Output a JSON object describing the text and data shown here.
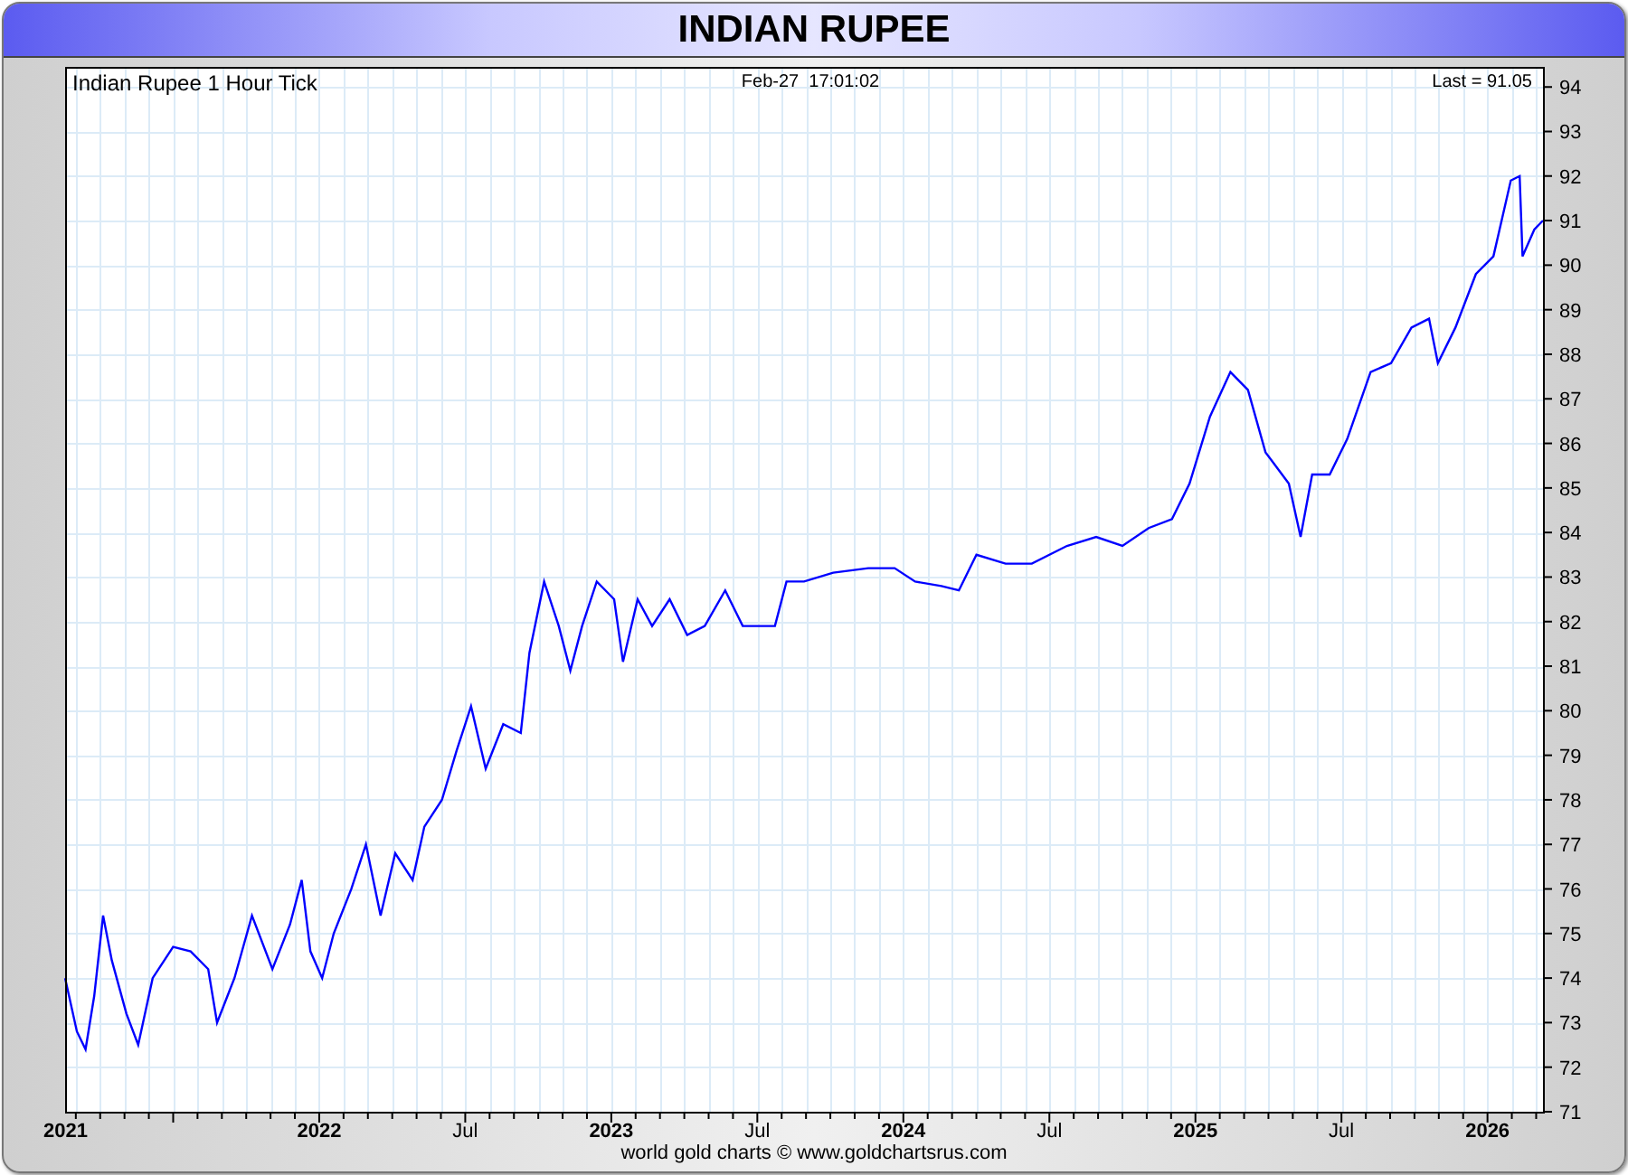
{
  "window": {
    "title": "INDIAN RUPEE"
  },
  "chart": {
    "timestamp": "Feb-27  17:01:02",
    "last": "Last = 91.05",
    "chart_data": {
      "type": "line",
      "title": "Indian Rupee 1 Hour Tick",
      "grid": true,
      "x": [
        2021.13,
        2021.17,
        2021.2,
        2021.23,
        2021.26,
        2021.29,
        2021.34,
        2021.38,
        2021.43,
        2021.5,
        2021.56,
        2021.62,
        2021.65,
        2021.71,
        2021.77,
        2021.84,
        2021.9,
        2021.94,
        2021.97,
        2022.01,
        2022.05,
        2022.11,
        2022.16,
        2022.21,
        2022.26,
        2022.32,
        2022.36,
        2022.42,
        2022.47,
        2022.52,
        2022.57,
        2022.63,
        2022.69,
        2022.72,
        2022.77,
        2022.82,
        2022.86,
        2022.9,
        2022.95,
        2023.01,
        2023.04,
        2023.09,
        2023.14,
        2023.2,
        2023.26,
        2023.32,
        2023.39,
        2023.45,
        2023.51,
        2023.56,
        2023.6,
        2023.66,
        2023.76,
        2023.88,
        2023.97,
        2024.04,
        2024.13,
        2024.19,
        2024.25,
        2024.35,
        2024.44,
        2024.56,
        2024.66,
        2024.75,
        2024.84,
        2024.92,
        2024.98,
        2025.05,
        2025.12,
        2025.18,
        2025.24,
        2025.32,
        2025.36,
        2025.4,
        2025.46,
        2025.52,
        2025.6,
        2025.67,
        2025.74,
        2025.8,
        2025.83,
        2025.89,
        2025.96,
        2026.02,
        2026.08,
        2026.11,
        2026.12,
        2026.16,
        2026.19
      ],
      "series": [
        {
          "color": "#0000ff",
          "values": [
            74.0,
            72.8,
            72.4,
            73.6,
            75.4,
            74.4,
            73.2,
            72.5,
            74.0,
            74.7,
            74.6,
            74.2,
            73.0,
            74.0,
            75.4,
            74.2,
            75.2,
            76.2,
            74.6,
            74.0,
            75.0,
            76.0,
            77.0,
            75.4,
            76.8,
            76.2,
            77.4,
            78.0,
            79.1,
            80.1,
            78.7,
            79.7,
            79.5,
            81.3,
            82.9,
            81.9,
            80.9,
            81.9,
            82.9,
            82.5,
            81.1,
            82.5,
            81.9,
            82.5,
            81.7,
            81.9,
            82.7,
            81.9,
            81.9,
            81.9,
            82.9,
            82.9,
            83.1,
            83.2,
            83.2,
            82.9,
            82.8,
            82.7,
            83.5,
            83.3,
            83.3,
            83.7,
            83.9,
            83.7,
            84.1,
            84.3,
            85.1,
            86.6,
            87.6,
            87.2,
            85.8,
            85.1,
            83.9,
            85.3,
            85.3,
            86.1,
            87.6,
            87.8,
            88.6,
            88.8,
            87.8,
            88.6,
            89.8,
            90.2,
            91.9,
            92.0,
            90.2,
            90.8,
            91.0
          ]
        }
      ],
      "xlim": [
        2021.13,
        2026.19
      ],
      "ylim": [
        71,
        94.45
      ],
      "xticks": [
        {
          "value": 2021.13,
          "label": "2021"
        },
        {
          "value": 2022,
          "label": "2022"
        },
        {
          "value": 2022.5,
          "label": "Jul"
        },
        {
          "value": 2023,
          "label": "2023"
        },
        {
          "value": 2023.5,
          "label": "Jul"
        },
        {
          "value": 2024,
          "label": "2024"
        },
        {
          "value": 2024.5,
          "label": "Jul"
        },
        {
          "value": 2025,
          "label": "2025"
        },
        {
          "value": 2025.5,
          "label": "Jul"
        },
        {
          "value": 2026,
          "label": "2026"
        }
      ],
      "yticks": [
        71,
        72,
        73,
        74,
        75,
        76,
        77,
        78,
        79,
        80,
        81,
        82,
        83,
        84,
        85,
        86,
        87,
        88,
        89,
        90,
        91,
        92,
        93,
        94
      ]
    }
  },
  "footer": "world gold charts © www.goldchartsrus.com"
}
